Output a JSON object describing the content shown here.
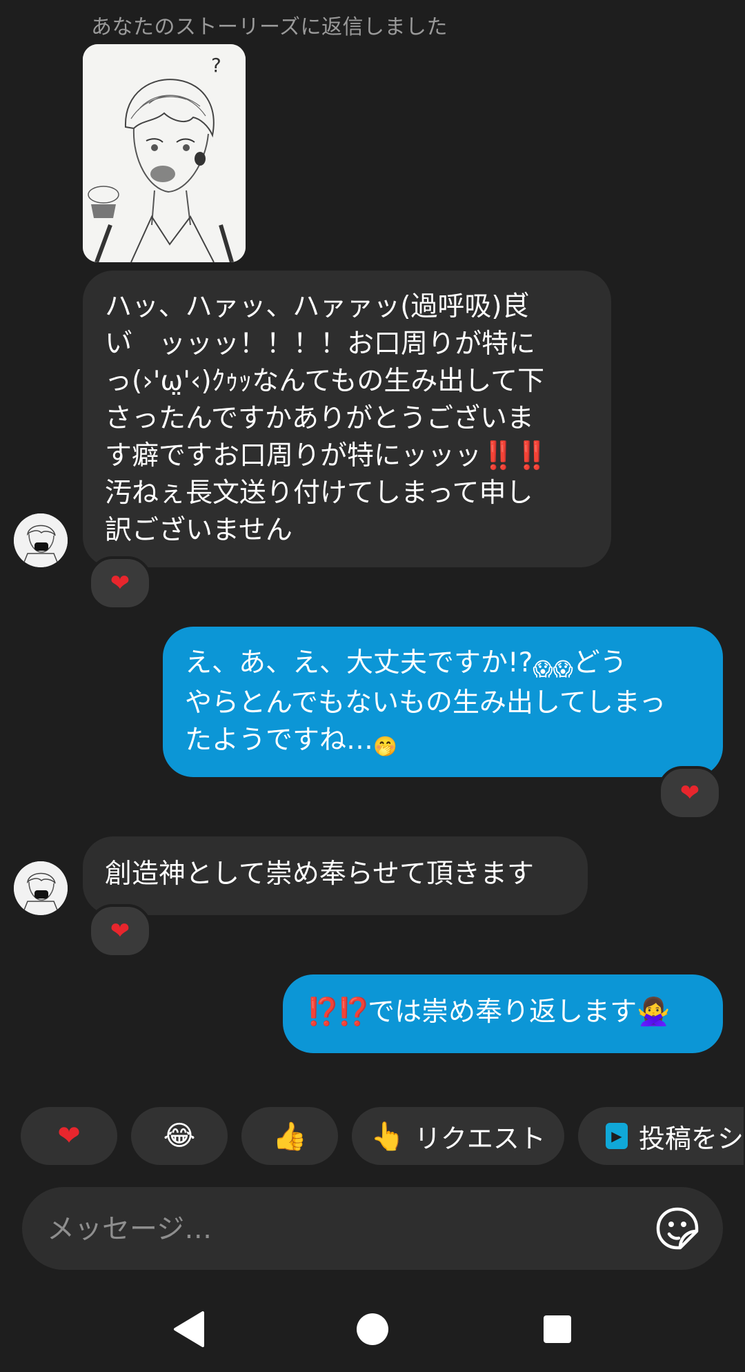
{
  "story_reply": {
    "note": "あなたのストーリーズに返信しました"
  },
  "messages": [
    {
      "sender": "them",
      "text": "ハッ、ハァッ、ハァァッ(過呼吸)良゙\nい゙　ッッッ！！！！お口周りが特に\nっ(›'ω̤'‹)ｸｩｯなんてもの生み出して下\nさったんですかありがとうございま\nす癖ですお口周りが特にッッッ‼️‼️\n汚ねぇ長文送り付けてしまって申し\n訳ございません",
      "reaction": "❤"
    },
    {
      "sender": "me",
      "text_parts": [
        "え、あ、え、大丈夫ですか!?",
        "😱😱",
        "どう\nやらとんでもないもの生み出してしまっ\nたようですね…",
        "🤭"
      ],
      "reaction": "❤"
    },
    {
      "sender": "them",
      "text": "創造神として崇め奉らせて頂きます",
      "reaction": "❤"
    },
    {
      "sender": "me",
      "text_parts": [
        "⁉️⁉️",
        "では崇め奉り返します",
        "🙅‍♀️"
      ]
    }
  ],
  "quick_replies": [
    {
      "glyph": "❤",
      "label": ""
    },
    {
      "glyph": "😂",
      "label": ""
    },
    {
      "glyph": "👍",
      "label": ""
    },
    {
      "glyph": "👆",
      "label": "リクエスト"
    },
    {
      "glyph": "▶",
      "label": "投稿をシ"
    }
  ],
  "composer": {
    "placeholder": "メッセージ…"
  },
  "colors": {
    "background": "#1e1e1e",
    "incoming_bubble": "#2e2e2e",
    "outgoing_bubble": "#0c96d6",
    "heart": "#e8262d"
  },
  "icons": {
    "composer_action": "sticker-icon",
    "nav_back": "back-triangle-icon",
    "nav_home": "home-circle-icon",
    "nav_recents": "recents-square-icon"
  }
}
